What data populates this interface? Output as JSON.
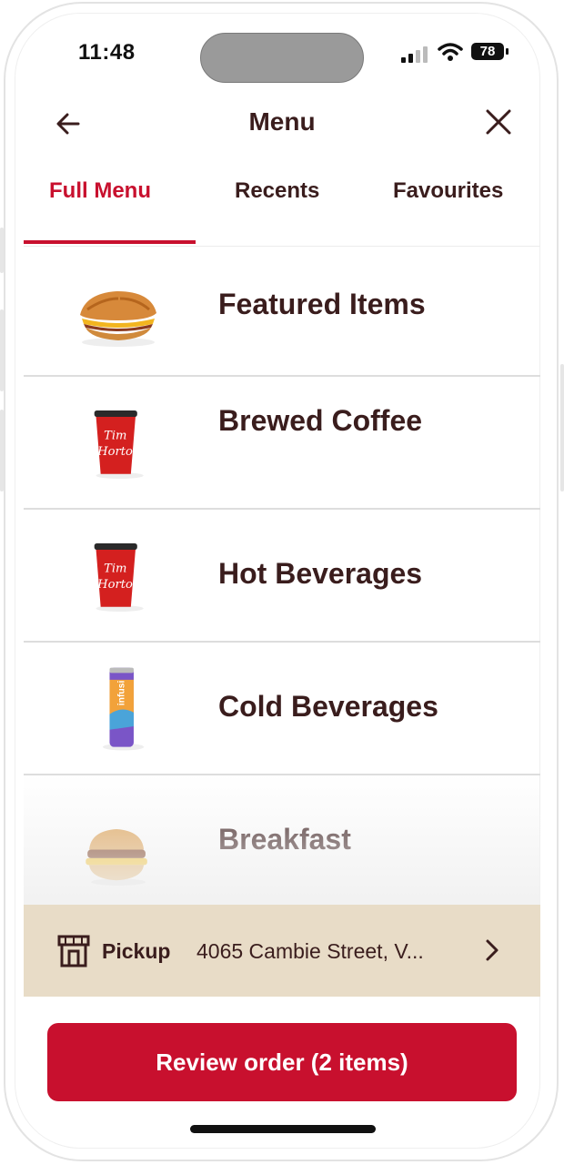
{
  "status_bar": {
    "time": "11:48",
    "battery": "78"
  },
  "header": {
    "title": "Menu"
  },
  "tabs": [
    {
      "label": "Full Menu",
      "active": true
    },
    {
      "label": "Recents",
      "active": false
    },
    {
      "label": "Favourites",
      "active": false
    }
  ],
  "menu_items": [
    {
      "label": "Featured Items",
      "icon": "croissant-sandwich-icon"
    },
    {
      "label": "Brewed Coffee",
      "icon": "coffee-cup-icon"
    },
    {
      "label": "Hot Beverages",
      "icon": "coffee-cup-icon"
    },
    {
      "label": "Cold Beverages",
      "icon": "beverage-can-icon"
    },
    {
      "label": "Breakfast",
      "icon": "breakfast-sandwich-icon"
    }
  ],
  "pickup": {
    "label": "Pickup",
    "address": "4065 Cambie Street, V..."
  },
  "review_button": {
    "label": "Review order (2 items)"
  },
  "colors": {
    "brand_red": "#c8102e",
    "text_brown": "#3a1d1d",
    "pickup_bg": "#e8dcc7"
  }
}
